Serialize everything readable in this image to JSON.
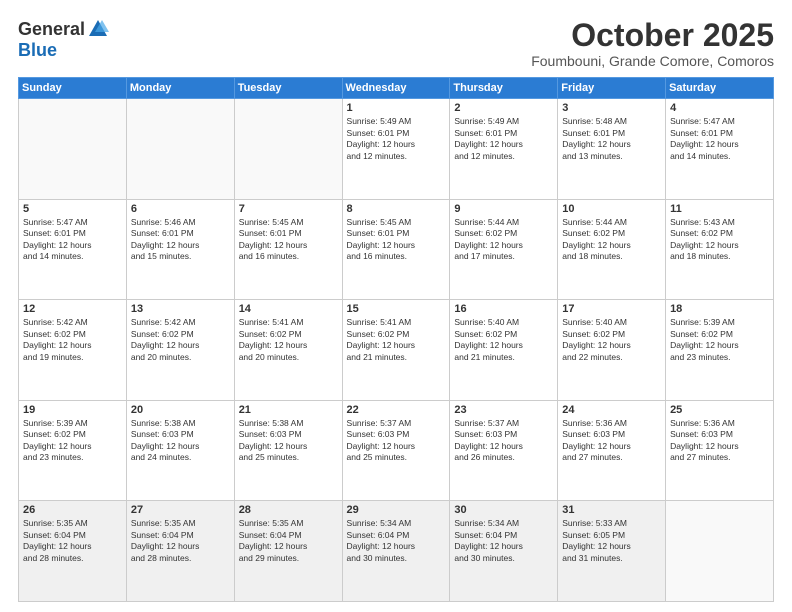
{
  "header": {
    "logo_general": "General",
    "logo_blue": "Blue",
    "month_title": "October 2025",
    "location": "Foumbouni, Grande Comore, Comoros"
  },
  "weekdays": [
    "Sunday",
    "Monday",
    "Tuesday",
    "Wednesday",
    "Thursday",
    "Friday",
    "Saturday"
  ],
  "weeks": [
    [
      {
        "day": "",
        "info": ""
      },
      {
        "day": "",
        "info": ""
      },
      {
        "day": "",
        "info": ""
      },
      {
        "day": "1",
        "info": "Sunrise: 5:49 AM\nSunset: 6:01 PM\nDaylight: 12 hours\nand 12 minutes."
      },
      {
        "day": "2",
        "info": "Sunrise: 5:49 AM\nSunset: 6:01 PM\nDaylight: 12 hours\nand 12 minutes."
      },
      {
        "day": "3",
        "info": "Sunrise: 5:48 AM\nSunset: 6:01 PM\nDaylight: 12 hours\nand 13 minutes."
      },
      {
        "day": "4",
        "info": "Sunrise: 5:47 AM\nSunset: 6:01 PM\nDaylight: 12 hours\nand 14 minutes."
      }
    ],
    [
      {
        "day": "5",
        "info": "Sunrise: 5:47 AM\nSunset: 6:01 PM\nDaylight: 12 hours\nand 14 minutes."
      },
      {
        "day": "6",
        "info": "Sunrise: 5:46 AM\nSunset: 6:01 PM\nDaylight: 12 hours\nand 15 minutes."
      },
      {
        "day": "7",
        "info": "Sunrise: 5:45 AM\nSunset: 6:01 PM\nDaylight: 12 hours\nand 16 minutes."
      },
      {
        "day": "8",
        "info": "Sunrise: 5:45 AM\nSunset: 6:01 PM\nDaylight: 12 hours\nand 16 minutes."
      },
      {
        "day": "9",
        "info": "Sunrise: 5:44 AM\nSunset: 6:02 PM\nDaylight: 12 hours\nand 17 minutes."
      },
      {
        "day": "10",
        "info": "Sunrise: 5:44 AM\nSunset: 6:02 PM\nDaylight: 12 hours\nand 18 minutes."
      },
      {
        "day": "11",
        "info": "Sunrise: 5:43 AM\nSunset: 6:02 PM\nDaylight: 12 hours\nand 18 minutes."
      }
    ],
    [
      {
        "day": "12",
        "info": "Sunrise: 5:42 AM\nSunset: 6:02 PM\nDaylight: 12 hours\nand 19 minutes."
      },
      {
        "day": "13",
        "info": "Sunrise: 5:42 AM\nSunset: 6:02 PM\nDaylight: 12 hours\nand 20 minutes."
      },
      {
        "day": "14",
        "info": "Sunrise: 5:41 AM\nSunset: 6:02 PM\nDaylight: 12 hours\nand 20 minutes."
      },
      {
        "day": "15",
        "info": "Sunrise: 5:41 AM\nSunset: 6:02 PM\nDaylight: 12 hours\nand 21 minutes."
      },
      {
        "day": "16",
        "info": "Sunrise: 5:40 AM\nSunset: 6:02 PM\nDaylight: 12 hours\nand 21 minutes."
      },
      {
        "day": "17",
        "info": "Sunrise: 5:40 AM\nSunset: 6:02 PM\nDaylight: 12 hours\nand 22 minutes."
      },
      {
        "day": "18",
        "info": "Sunrise: 5:39 AM\nSunset: 6:02 PM\nDaylight: 12 hours\nand 23 minutes."
      }
    ],
    [
      {
        "day": "19",
        "info": "Sunrise: 5:39 AM\nSunset: 6:02 PM\nDaylight: 12 hours\nand 23 minutes."
      },
      {
        "day": "20",
        "info": "Sunrise: 5:38 AM\nSunset: 6:03 PM\nDaylight: 12 hours\nand 24 minutes."
      },
      {
        "day": "21",
        "info": "Sunrise: 5:38 AM\nSunset: 6:03 PM\nDaylight: 12 hours\nand 25 minutes."
      },
      {
        "day": "22",
        "info": "Sunrise: 5:37 AM\nSunset: 6:03 PM\nDaylight: 12 hours\nand 25 minutes."
      },
      {
        "day": "23",
        "info": "Sunrise: 5:37 AM\nSunset: 6:03 PM\nDaylight: 12 hours\nand 26 minutes."
      },
      {
        "day": "24",
        "info": "Sunrise: 5:36 AM\nSunset: 6:03 PM\nDaylight: 12 hours\nand 27 minutes."
      },
      {
        "day": "25",
        "info": "Sunrise: 5:36 AM\nSunset: 6:03 PM\nDaylight: 12 hours\nand 27 minutes."
      }
    ],
    [
      {
        "day": "26",
        "info": "Sunrise: 5:35 AM\nSunset: 6:04 PM\nDaylight: 12 hours\nand 28 minutes."
      },
      {
        "day": "27",
        "info": "Sunrise: 5:35 AM\nSunset: 6:04 PM\nDaylight: 12 hours\nand 28 minutes."
      },
      {
        "day": "28",
        "info": "Sunrise: 5:35 AM\nSunset: 6:04 PM\nDaylight: 12 hours\nand 29 minutes."
      },
      {
        "day": "29",
        "info": "Sunrise: 5:34 AM\nSunset: 6:04 PM\nDaylight: 12 hours\nand 30 minutes."
      },
      {
        "day": "30",
        "info": "Sunrise: 5:34 AM\nSunset: 6:04 PM\nDaylight: 12 hours\nand 30 minutes."
      },
      {
        "day": "31",
        "info": "Sunrise: 5:33 AM\nSunset: 6:05 PM\nDaylight: 12 hours\nand 31 minutes."
      },
      {
        "day": "",
        "info": ""
      }
    ]
  ]
}
